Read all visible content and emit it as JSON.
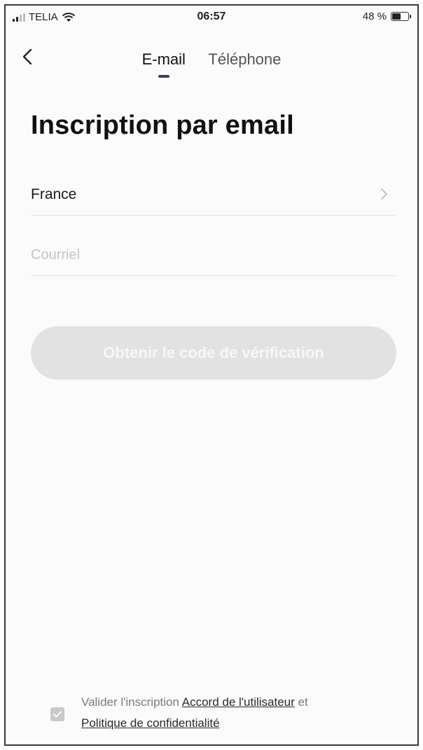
{
  "status_bar": {
    "carrier": "TELIA",
    "time": "06:57",
    "battery": "48 %",
    "battery_level": 0.48
  },
  "nav": {
    "tabs": [
      {
        "label": "E-mail",
        "active": true
      },
      {
        "label": "Téléphone",
        "active": false
      }
    ]
  },
  "page": {
    "title": "Inscription par email"
  },
  "form": {
    "country": "France",
    "email_placeholder": "Courriel",
    "email_value": "",
    "submit_label": "Obtenir le code de vérification"
  },
  "consent": {
    "prefix": "Valider l'inscription ",
    "user_agreement": "Accord de l'utilisateur",
    "conjunction": " et",
    "privacy_policy": "Politique de confidentialité",
    "checked": true
  },
  "colors": {
    "tab_indicator": "#3a3d5c",
    "button_disabled": "#e2e2e2",
    "divider": "#e4e4e4"
  }
}
